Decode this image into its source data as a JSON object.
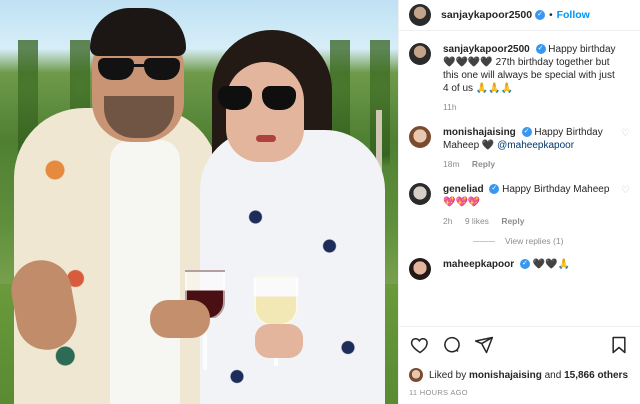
{
  "post": {
    "username": "sanjaykapoor2500",
    "follow_label": "Follow",
    "dot": "•",
    "caption": {
      "username": "sanjaykapoor2500",
      "text": "Happy birthday 🖤🖤🖤🖤 27th birthday together but this one will always be special with just 4 of us 🙏🙏🙏",
      "time": "11h"
    },
    "comments": [
      {
        "username": "monishajaising",
        "text": "Happy Birthday Maheep 🖤",
        "mention": "@maheepkapoor",
        "time": "18m",
        "reply_label": "Reply",
        "likes": ""
      },
      {
        "username": "geneliad",
        "text": "Happy Birthday Maheep 💖💖💖",
        "mention": "",
        "time": "2h",
        "likes": "9 likes",
        "reply_label": "Reply"
      },
      {
        "username": "maheepkapoor",
        "text": "🖤🖤🙏",
        "mention": "",
        "time": "",
        "likes": "",
        "reply_label": ""
      }
    ],
    "view_replies": "View replies (1)",
    "liked_by": {
      "prefix": "Liked by",
      "user": "monishajaising",
      "and": "and",
      "count": "15,866 others"
    },
    "posted_ago": "11 HOURS AGO",
    "icons": {
      "like": "heart-icon",
      "comment": "comment-icon",
      "share": "share-icon",
      "save": "bookmark-icon"
    },
    "colors": {
      "accent": "#0095f6",
      "verified": "#3897f0",
      "muted": "#8e8e8e",
      "text": "#262626"
    }
  }
}
